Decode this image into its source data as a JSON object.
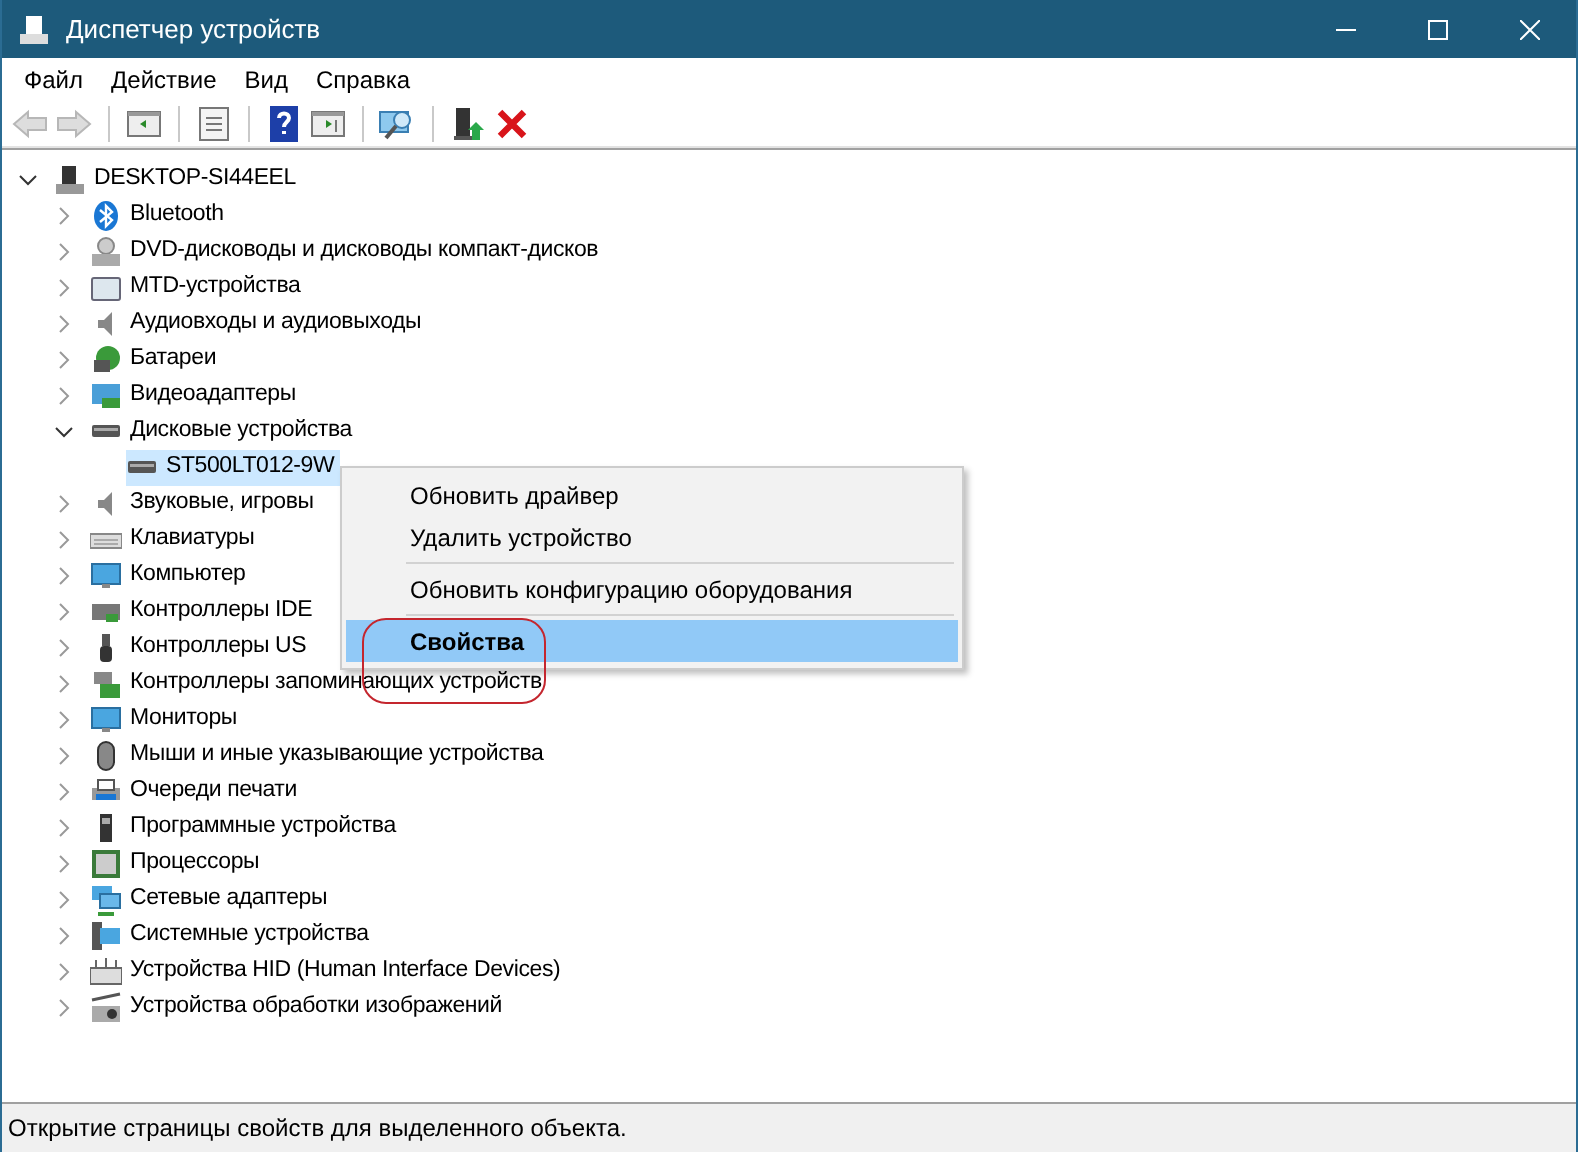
{
  "window": {
    "title": "Диспетчер устройств"
  },
  "menu": [
    "Файл",
    "Действие",
    "Вид",
    "Справка"
  ],
  "toolbar": [
    {
      "kind": "back",
      "disabled": true
    },
    {
      "kind": "forward",
      "disabled": true
    },
    {
      "kind": "separator"
    },
    {
      "kind": "console",
      "disabled": false
    },
    {
      "kind": "separator"
    },
    {
      "kind": "properties",
      "disabled": false
    },
    {
      "kind": "separator"
    },
    {
      "kind": "help",
      "disabled": false
    },
    {
      "kind": "action-pane",
      "disabled": false
    },
    {
      "kind": "separator"
    },
    {
      "kind": "scan",
      "disabled": false
    },
    {
      "kind": "separator"
    },
    {
      "kind": "update",
      "disabled": false
    },
    {
      "kind": "remove",
      "disabled": false
    }
  ],
  "tree": {
    "label": "DESKTOP-SI44EEL",
    "kind": "computer",
    "expanded": true,
    "selected": false,
    "children": [
      {
        "label": "Bluetooth",
        "kind": "bluetooth",
        "expanded": false,
        "selected": false
      },
      {
        "label": "DVD-дисководы и дисководы компакт-дисков",
        "kind": "dvd",
        "expanded": false,
        "selected": false
      },
      {
        "label": "MTD-устройства",
        "kind": "mtd",
        "expanded": false,
        "selected": false
      },
      {
        "label": "Аудиовходы и аудиовыходы",
        "kind": "speaker",
        "expanded": false,
        "selected": false
      },
      {
        "label": "Батареи",
        "kind": "battery",
        "expanded": false,
        "selected": false
      },
      {
        "label": "Видеоадаптеры",
        "kind": "display",
        "expanded": false,
        "selected": false
      },
      {
        "label": "Дисковые устройства",
        "kind": "disk",
        "expanded": true,
        "selected": false,
        "children": [
          {
            "label": "ST500LT012-9W",
            "kind": "disk",
            "selected": true
          }
        ]
      },
      {
        "label": "Звуковые, игровы",
        "kind": "speaker",
        "expanded": false,
        "selected": false
      },
      {
        "label": "Клавиатуры",
        "kind": "keyboard",
        "expanded": false,
        "selected": false
      },
      {
        "label": "Компьютер",
        "kind": "monitor",
        "expanded": false,
        "selected": false
      },
      {
        "label": "Контроллеры IDE",
        "kind": "card",
        "expanded": false,
        "selected": false
      },
      {
        "label": "Контроллеры US",
        "kind": "usb",
        "expanded": false,
        "selected": false
      },
      {
        "label": "Контроллеры запоминающих устройств",
        "kind": "storage",
        "expanded": false,
        "selected": false
      },
      {
        "label": "Мониторы",
        "kind": "monitor",
        "expanded": false,
        "selected": false
      },
      {
        "label": "Мыши и иные указывающие устройства",
        "kind": "mouse",
        "expanded": false,
        "selected": false
      },
      {
        "label": "Очереди печати",
        "kind": "printer",
        "expanded": false,
        "selected": false
      },
      {
        "label": "Программные устройства",
        "kind": "software",
        "expanded": false,
        "selected": false
      },
      {
        "label": "Процессоры",
        "kind": "cpu",
        "expanded": false,
        "selected": false
      },
      {
        "label": "Сетевые адаптеры",
        "kind": "network",
        "expanded": false,
        "selected": false
      },
      {
        "label": "Системные устройства",
        "kind": "system",
        "expanded": false,
        "selected": false
      },
      {
        "label": "Устройства HID (Human Interface Devices)",
        "kind": "hid",
        "expanded": false,
        "selected": false
      },
      {
        "label": "Устройства обработки изображений",
        "kind": "camera",
        "expanded": false,
        "selected": false
      }
    ]
  },
  "context_menu": [
    {
      "kind": "item",
      "label": "Обновить драйвер",
      "selected": false,
      "default": false
    },
    {
      "kind": "item",
      "label": "Удалить устройство",
      "selected": false,
      "default": false
    },
    {
      "kind": "separator"
    },
    {
      "kind": "item",
      "label": "Обновить конфигурацию оборудования",
      "selected": false,
      "default": false
    },
    {
      "kind": "separator"
    },
    {
      "kind": "item",
      "label": "Свойства",
      "selected": true,
      "default": true
    }
  ],
  "annotation_circle": true,
  "status_bar": "Открытие страницы свойств для выделенного объекта."
}
